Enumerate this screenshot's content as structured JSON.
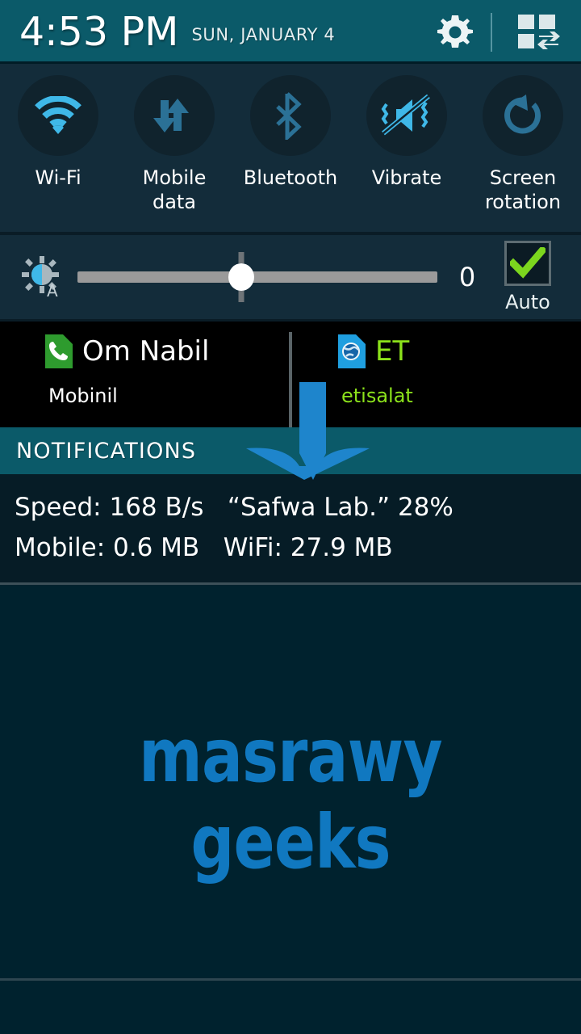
{
  "status_bar": {
    "time": "4:53 PM",
    "date": "SUN, JANUARY 4",
    "settings_icon": "gear-icon",
    "quick_toggle_icon": "grid-swap-icon"
  },
  "quick_settings": {
    "toggles": [
      {
        "label": "Wi-Fi",
        "icon": "wifi-icon",
        "state": "on"
      },
      {
        "label": "Mobile\ndata",
        "icon": "mobile-data-icon",
        "state": "off"
      },
      {
        "label": "Bluetooth",
        "icon": "bluetooth-icon",
        "state": "off"
      },
      {
        "label": "Vibrate",
        "icon": "vibrate-mute-icon",
        "state": "on"
      },
      {
        "label": "Screen\nrotation",
        "icon": "screen-rotation-icon",
        "state": "off"
      }
    ],
    "colors": {
      "on": "#3FB8E8",
      "off": "#2B7196",
      "circle": "#10232D",
      "panel": "#132C3A"
    }
  },
  "brightness": {
    "icon": "brightness-auto-icon",
    "value": "0",
    "slider_percent": 45,
    "auto_label": "Auto",
    "auto_checked": true,
    "check_color": "#7CD61E"
  },
  "sim_cards": [
    {
      "name": "Om Nabil",
      "carrier": "Mobinil",
      "icon": "sim-phone-icon",
      "icon_color": "#2E9B2E",
      "text_color": "#FFFFFF"
    },
    {
      "name": "ET",
      "carrier": "etisalat",
      "icon": "sim-globe-icon",
      "icon_color": "#1F9FE0",
      "text_color": "#8CE21B"
    }
  ],
  "notifications": {
    "header": "NOTIFICATIONS",
    "items": [
      {
        "line1": "Speed: 168 B/s   “Safwa Lab.” 28%",
        "line2": "Mobile: 0.6 MB   WiFi: 27.9 MB"
      }
    ]
  },
  "watermark": {
    "text": "masrawy geeks",
    "color": "#1078C0"
  },
  "overlay": {
    "arrow_color": "#1E85CC",
    "arrow_direction": "down"
  },
  "theme": {
    "teal": "#0B5A69",
    "panel_dark": "#132C3A",
    "background": "#00222E",
    "notif_bg": "#061C26"
  }
}
